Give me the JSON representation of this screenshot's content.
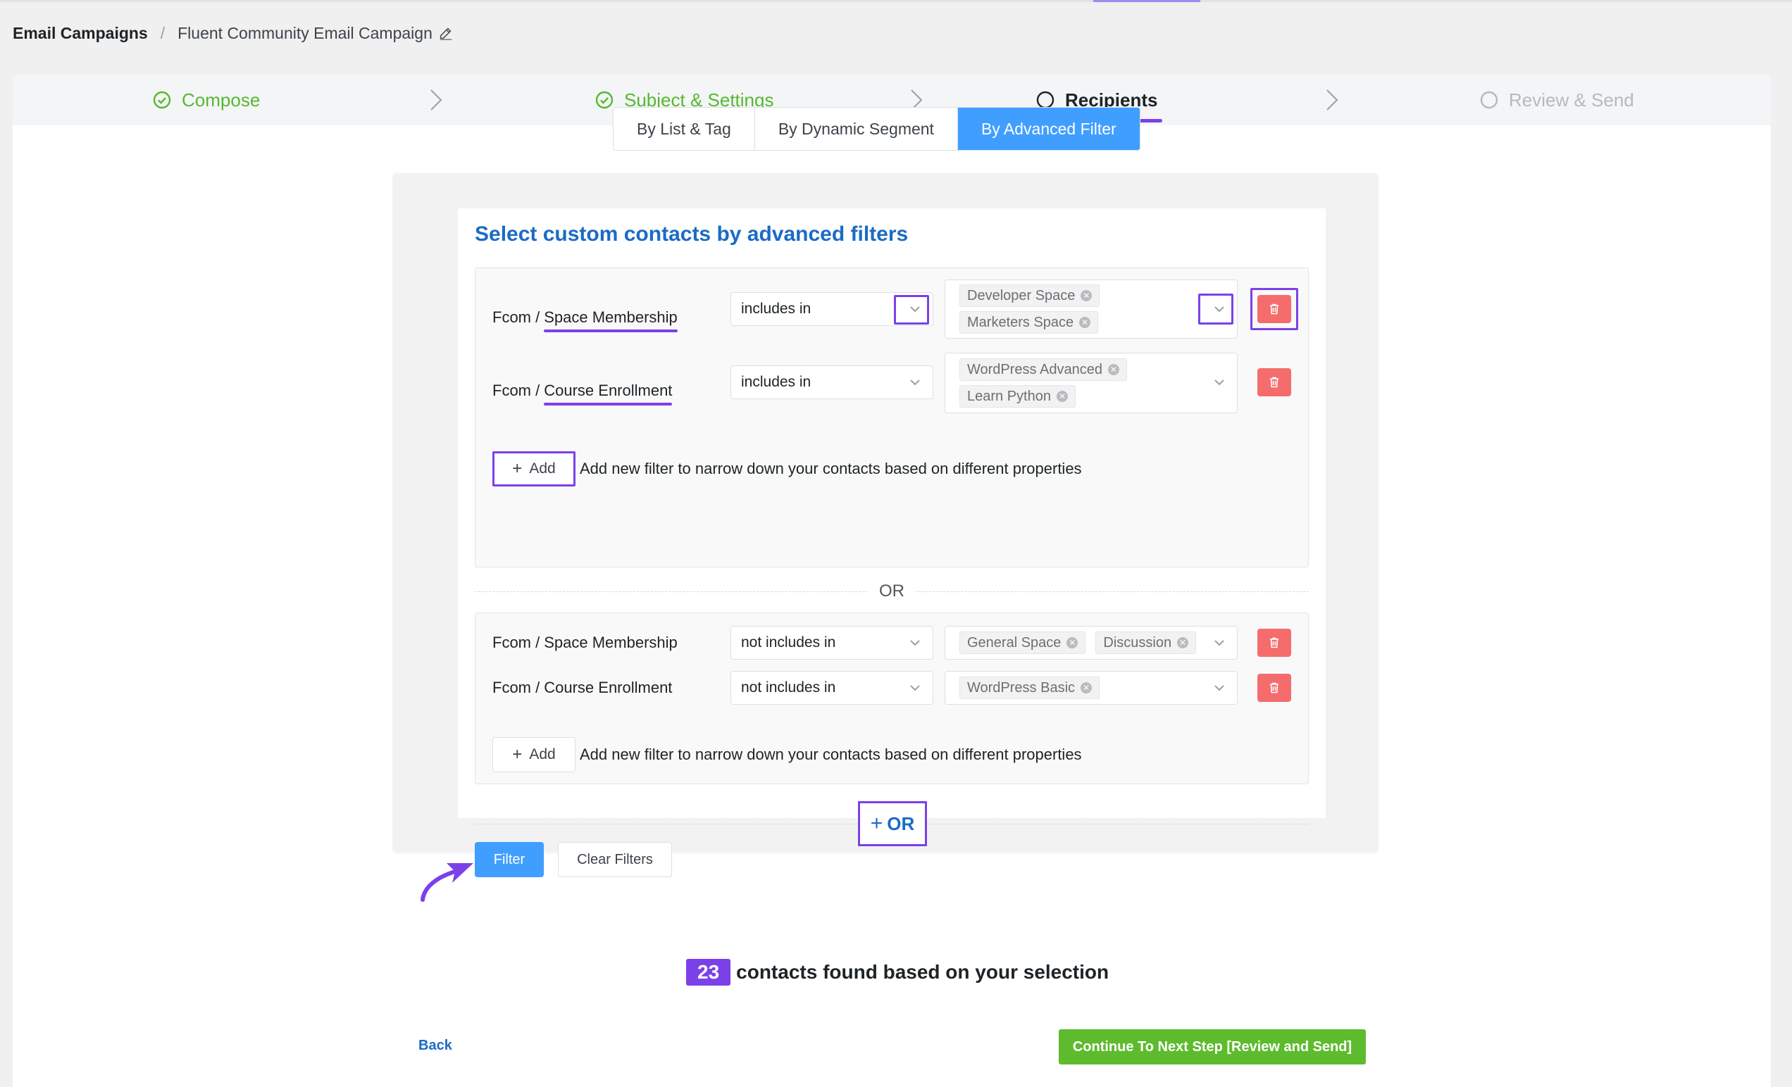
{
  "breadcrumb": {
    "root": "Email Campaigns",
    "separator": "/",
    "current": "Fluent Community Email Campaign"
  },
  "steps": [
    {
      "label": "Compose",
      "state": "done"
    },
    {
      "label": "Subject & Settings",
      "state": "done"
    },
    {
      "label": "Recipients",
      "state": "active"
    },
    {
      "label": "Review & Send",
      "state": "pending"
    }
  ],
  "segment": {
    "options": [
      "By List & Tag",
      "By Dynamic Segment",
      "By Advanced Filter"
    ],
    "selected": "By Advanced Filter"
  },
  "filters": {
    "title": "Select custom contacts by advanced filters",
    "groups": [
      {
        "rows": [
          {
            "source": "Fcom /",
            "property": "Space Membership",
            "operator": "includes in",
            "values": [
              "Developer Space",
              "Marketers Space"
            ]
          },
          {
            "source": "Fcom /",
            "property": "Course Enrollment",
            "operator": "includes in",
            "values": [
              "WordPress Advanced",
              "Learn Python"
            ]
          }
        ],
        "add_label": "Add",
        "add_hint": "Add new filter to narrow down your contacts based on different properties"
      },
      {
        "rows": [
          {
            "source": "Fcom /",
            "property": "Space Membership",
            "operator": "not includes in",
            "values": [
              "General Space",
              "Discussion"
            ]
          },
          {
            "source": "Fcom /",
            "property": "Course Enrollment",
            "operator": "not includes in",
            "values": [
              "WordPress Basic"
            ]
          }
        ],
        "add_label": "Add",
        "add_hint": "Add new filter to narrow down your contacts based on different properties"
      }
    ],
    "or_label": "OR",
    "or_add_label": "OR",
    "filter_button": "Filter",
    "clear_button": "Clear Filters"
  },
  "result": {
    "count": "23",
    "text": "contacts found based on your selection"
  },
  "footer": {
    "back": "Back",
    "continue": "Continue To Next Step [Review and Send]"
  },
  "colors": {
    "accent_purple": "#7b41e8",
    "primary_blue": "#409eff",
    "success_green": "#5ebb2e",
    "danger_red": "#f56c6c",
    "title_blue": "#1b6bc6"
  }
}
